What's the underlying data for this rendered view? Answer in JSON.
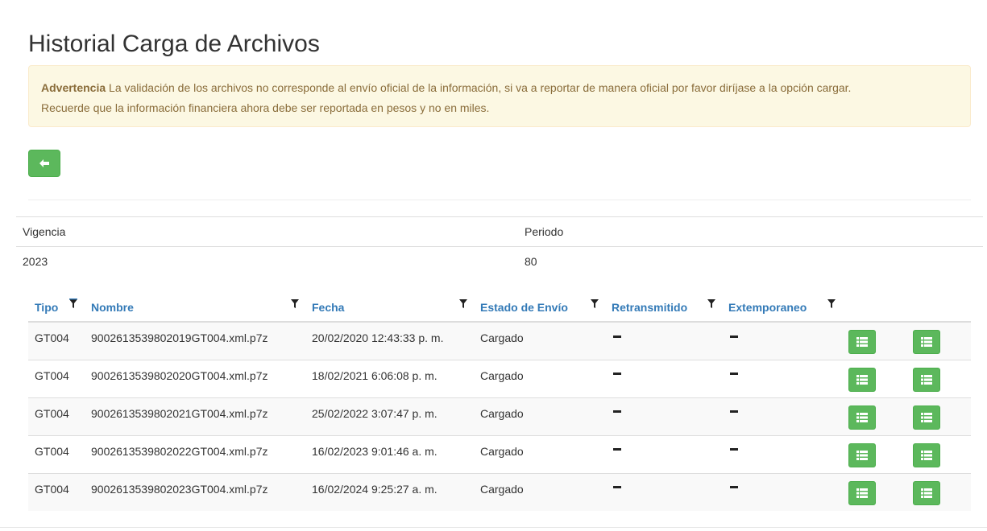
{
  "page": {
    "title": "Historial Carga de Archivos"
  },
  "alert": {
    "strong": "Advertencia",
    "line1": " La validación de los archivos no corresponde al envío oficial de la información, si va a reportar de manera oficial por favor diríjase a la opción cargar.",
    "line2": "Recuerde que la información financiera ahora debe ser reportada en pesos y no en miles."
  },
  "back_button": {
    "icon": "arrow-left-icon"
  },
  "info": {
    "vigencia_label": "Vigencia",
    "periodo_label": "Periodo",
    "vigencia_value": "2023",
    "periodo_value": "80"
  },
  "grid": {
    "columns": [
      "Tipo",
      "Nombre",
      "Fecha",
      "Estado de Envío",
      "Retransmitido",
      "Extemporaneo"
    ],
    "rows": [
      {
        "tipo": "GT004",
        "nombre": "9002613539802019GT004.xml.p7z",
        "fecha": "20/02/2020 12:43:33 p. m.",
        "estado": "Cargado"
      },
      {
        "tipo": "GT004",
        "nombre": "9002613539802020GT004.xml.p7z",
        "fecha": "18/02/2021 6:06:08 p. m.",
        "estado": "Cargado"
      },
      {
        "tipo": "GT004",
        "nombre": "9002613539802021GT004.xml.p7z",
        "fecha": "25/02/2022 3:07:47 p. m.",
        "estado": "Cargado"
      },
      {
        "tipo": "GT004",
        "nombre": "9002613539802022GT004.xml.p7z",
        "fecha": "16/02/2023 9:01:46 a. m.",
        "estado": "Cargado"
      },
      {
        "tipo": "GT004",
        "nombre": "9002613539802023GT004.xml.p7z",
        "fecha": "16/02/2024 9:25:27 a. m.",
        "estado": "Cargado"
      }
    ]
  },
  "colors": {
    "accent": "#5cb85c",
    "link": "#337ab7",
    "warning_bg": "#fcf8e3",
    "warning_text": "#8a6d3b"
  }
}
